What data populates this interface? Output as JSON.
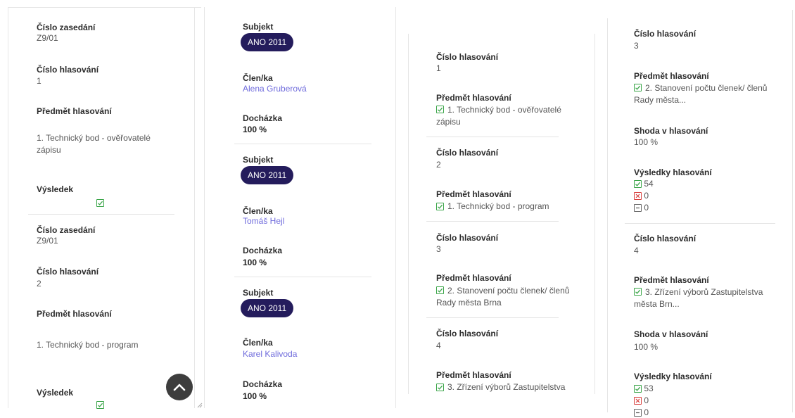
{
  "colors": {
    "pill_bg": "#241c5c",
    "link": "#6f6bdc",
    "check_green": "#3aa548",
    "cross_red": "#d9403e"
  },
  "panel1": {
    "blocks": [
      {
        "session_label": "Číslo zasedání",
        "session_value": "Z9/01",
        "vote_label": "Číslo hlasování",
        "vote_value": "1",
        "subject_label": "Předmět hlasování",
        "subject_value": "1. Technický bod - ověřovatelé zápisu",
        "result_label": "Výsledek"
      },
      {
        "session_label": "Číslo zasedání",
        "session_value": "Z9/01",
        "vote_label": "Číslo hlasování",
        "vote_value": "2",
        "subject_label": "Předmět hlasování",
        "subject_value": "1. Technický bod - program",
        "result_label": "Výsledek"
      }
    ]
  },
  "panel2": {
    "blocks": [
      {
        "subject_label": "Subjekt",
        "party": "ANO 2011",
        "member_label": "Člen/ka",
        "member": "Alena Gruberová",
        "attendance_label": "Docházka",
        "attendance": "100 %"
      },
      {
        "subject_label": "Subjekt",
        "party": "ANO 2011",
        "member_label": "Člen/ka",
        "member": "Tomáš Hejl",
        "attendance_label": "Docházka",
        "attendance": "100 %"
      },
      {
        "subject_label": "Subjekt",
        "party": "ANO 2011",
        "member_label": "Člen/ka",
        "member": "Karel Kalivoda",
        "attendance_label": "Docházka",
        "attendance": "100 %"
      }
    ]
  },
  "panel3": {
    "blocks": [
      {
        "vote_label": "Číslo hlasování",
        "vote_value": "1",
        "subject_label": "Předmět hlasování",
        "subject_value": "1. Technický bod - ověřovatelé zápisu"
      },
      {
        "vote_label": "Číslo hlasování",
        "vote_value": "2",
        "subject_label": "Předmět hlasování",
        "subject_value": "1. Technický bod - program"
      },
      {
        "vote_label": "Číslo hlasování",
        "vote_value": "3",
        "subject_label": "Předmět hlasování",
        "subject_value": "2. Stanovení počtu členek/ členů Rady města Brna"
      },
      {
        "vote_label": "Číslo hlasování",
        "vote_value": "4",
        "subject_label": "Předmět hlasování",
        "subject_value": "3. Zřízení výborů Zastupitelstva"
      }
    ]
  },
  "panel4": {
    "blocks": [
      {
        "vote_label": "Číslo hlasování",
        "vote_value": "3",
        "subject_label": "Předmět hlasování",
        "subject_value": "2. Stanovení počtu členek/ členů Rady města...",
        "agreement_label": "Shoda v hlasování",
        "agreement_value": "100 %",
        "results_label": "Výsledky hlasování",
        "yes": "54",
        "no": "0",
        "abstain": "0"
      },
      {
        "vote_label": "Číslo hlasování",
        "vote_value": "4",
        "subject_label": "Předmět hlasování",
        "subject_value": "3. Zřízení výborů Zastupitelstva města Brn...",
        "agreement_label": "Shoda v hlasování",
        "agreement_value": "100 %",
        "results_label": "Výsledky hlasování",
        "yes": "53",
        "no": "0",
        "abstain": "0"
      }
    ]
  }
}
